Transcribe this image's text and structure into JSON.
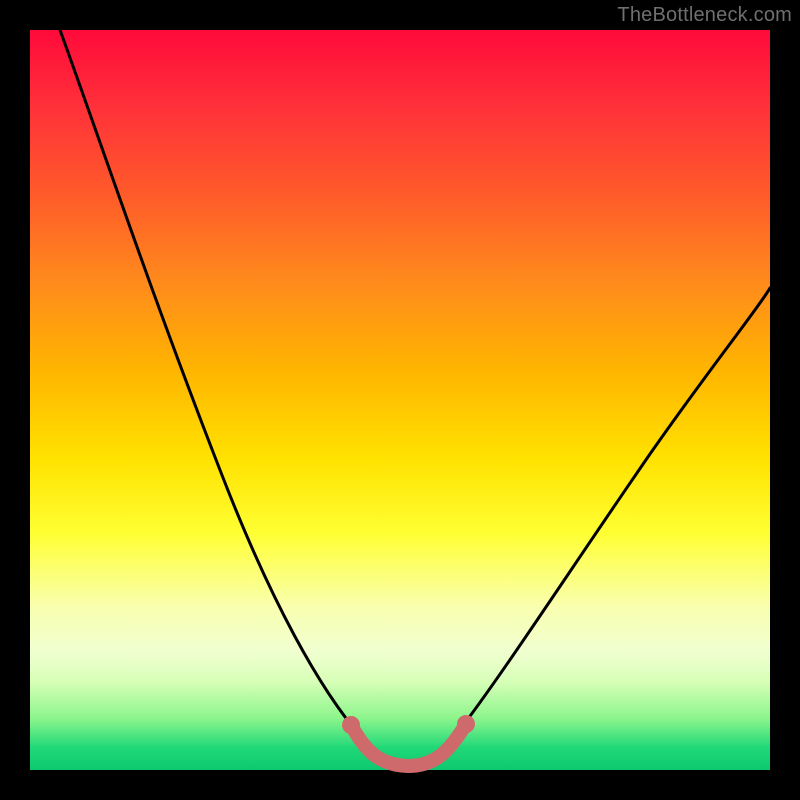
{
  "watermark": "TheBottleneck.com",
  "chart_data": {
    "type": "line",
    "title": "",
    "xlabel": "",
    "ylabel": "",
    "xlim": [
      0,
      100
    ],
    "ylim": [
      0,
      100
    ],
    "series": [
      {
        "name": "black-curve",
        "color": "#000000",
        "x": [
          4,
          8,
          12,
          16,
          20,
          24,
          28,
          32,
          36,
          40,
          43,
          46,
          49,
          52,
          55,
          58,
          62,
          68,
          74,
          80,
          86,
          92,
          98,
          100
        ],
        "y": [
          100,
          92,
          84,
          76,
          68,
          60,
          52,
          44,
          36,
          28,
          20,
          12,
          6,
          3,
          3,
          6,
          14,
          24,
          34,
          43,
          51,
          58,
          64,
          66
        ]
      },
      {
        "name": "highlight-u",
        "color": "#cf6a6c",
        "x": [
          43,
          46,
          49,
          52,
          55,
          58
        ],
        "y": [
          12,
          5,
          3,
          3,
          5,
          12
        ]
      }
    ],
    "annotations": []
  }
}
